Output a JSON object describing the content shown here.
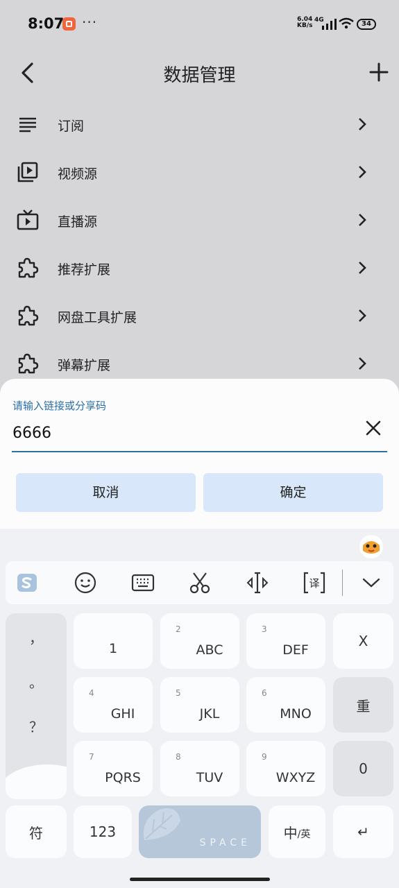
{
  "status_bar": {
    "time": "8:07",
    "more": "···",
    "net_speed": "6.04",
    "net_unit": "KB/s",
    "network_type": "4G",
    "battery": "34"
  },
  "header": {
    "title": "数据管理",
    "back_icon": "chevron-left-icon",
    "add_icon": "plus-icon"
  },
  "list": [
    {
      "label": "订阅",
      "icon": "list-lines-icon"
    },
    {
      "label": "视频源",
      "icon": "video-library-icon"
    },
    {
      "label": "直播源",
      "icon": "live-tv-icon"
    },
    {
      "label": "推荐扩展",
      "icon": "puzzle-extension-icon"
    },
    {
      "label": "网盘工具扩展",
      "icon": "puzzle-extension-icon"
    },
    {
      "label": "弹幕扩展",
      "icon": "puzzle-extension-icon"
    }
  ],
  "dialog": {
    "field_label": "请输入链接或分享码",
    "field_value": "6666",
    "cancel": "取消",
    "confirm": "确定",
    "accent": "#2f6f9c"
  },
  "keyboard": {
    "toolbar": [
      "sogou-logo-icon",
      "emoji-icon",
      "keyboard-icon",
      "scissors-icon",
      "cursor-move-icon",
      "translate-icon",
      "collapse-icon"
    ],
    "punctuation": [
      "，",
      "。",
      "？",
      "！"
    ],
    "keys": [
      {
        "num": "",
        "letters": "1"
      },
      {
        "num": "2",
        "letters": "ABC"
      },
      {
        "num": "3",
        "letters": "DEF"
      },
      {
        "num": "4",
        "letters": "GHI"
      },
      {
        "num": "5",
        "letters": "JKL"
      },
      {
        "num": "6",
        "letters": "MNO"
      },
      {
        "num": "7",
        "letters": "PQRS"
      },
      {
        "num": "8",
        "letters": "TUV"
      },
      {
        "num": "9",
        "letters": "WXYZ"
      }
    ],
    "delete": "X",
    "reenter": "重",
    "zero": "0",
    "symbol": "符",
    "numeric": "123",
    "space": "SPACE",
    "lang_main": "中",
    "lang_sub": "/英",
    "enter": "↵"
  }
}
